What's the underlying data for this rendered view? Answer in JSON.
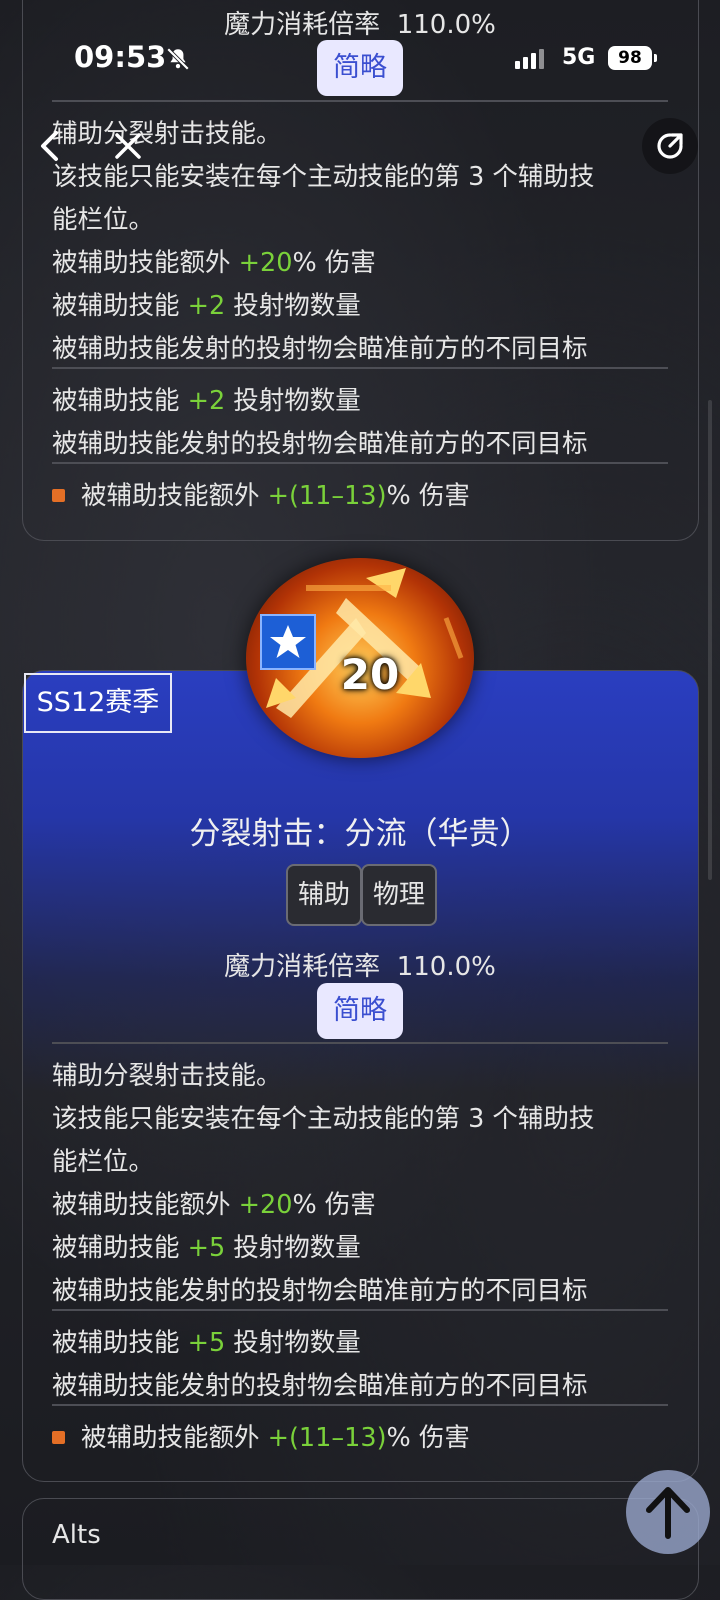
{
  "status": {
    "time": "09:53",
    "network": "5G",
    "battery": "98"
  },
  "nav": {
    "back_icon": "chevron-left-icon",
    "close_icon": "close-icon",
    "share_icon": "share-icon"
  },
  "top_card": {
    "mana_label": "魔力消耗倍率",
    "mana_value": "110.0%",
    "summary_button": "简略",
    "lines": [
      {
        "text": "辅助分裂射击技能。"
      },
      {
        "text": "该技能只能安装在每个主动技能的第 3 个辅助技"
      },
      {
        "text": "能栏位。"
      },
      {
        "pre": "被辅助技能额外 ",
        "hl": "+20",
        "post": "% 伤害"
      },
      {
        "pre": "被辅助技能 ",
        "hl": "+2",
        "post": " 投射物数量"
      },
      {
        "text": "被辅助技能发射的投射物会瞄准前方的不同目标"
      },
      {
        "pre": "被辅助技能 ",
        "hl": "+2",
        "post": " 投射物数量"
      },
      {
        "text": "被辅助技能发射的投射物会瞄准前方的不同目标"
      },
      {
        "pre": "被辅助技能额外 ",
        "hl": "+(11–13)",
        "post": "% 伤害"
      }
    ]
  },
  "skill_card": {
    "season_badge": "SS12赛季",
    "level": "20",
    "title": "分裂射击：分流（华贵）",
    "tags": [
      "辅助",
      "物理"
    ],
    "mana_label": "魔力消耗倍率",
    "mana_value": "110.0%",
    "summary_button": "简略",
    "lines": [
      {
        "text": "辅助分裂射击技能。"
      },
      {
        "text": "该技能只能安装在每个主动技能的第 3 个辅助技"
      },
      {
        "text": "能栏位。"
      },
      {
        "pre": "被辅助技能额外 ",
        "hl": "+20",
        "post": "% 伤害"
      },
      {
        "pre": "被辅助技能 ",
        "hl": "+5",
        "post": " 投射物数量"
      },
      {
        "text": "被辅助技能发射的投射物会瞄准前方的不同目标"
      },
      {
        "pre": "被辅助技能 ",
        "hl": "+5",
        "post": " 投射物数量"
      },
      {
        "text": "被辅助技能发射的投射物会瞄准前方的不同目标"
      },
      {
        "pre": "被辅助技能额外 ",
        "hl": "+(11–13)",
        "post": "% 伤害"
      }
    ]
  },
  "alts_label": "Alts",
  "colors": {
    "highlight": "#7ad13a",
    "accent": "#3b4fd0",
    "bullet": "#e46f26"
  }
}
